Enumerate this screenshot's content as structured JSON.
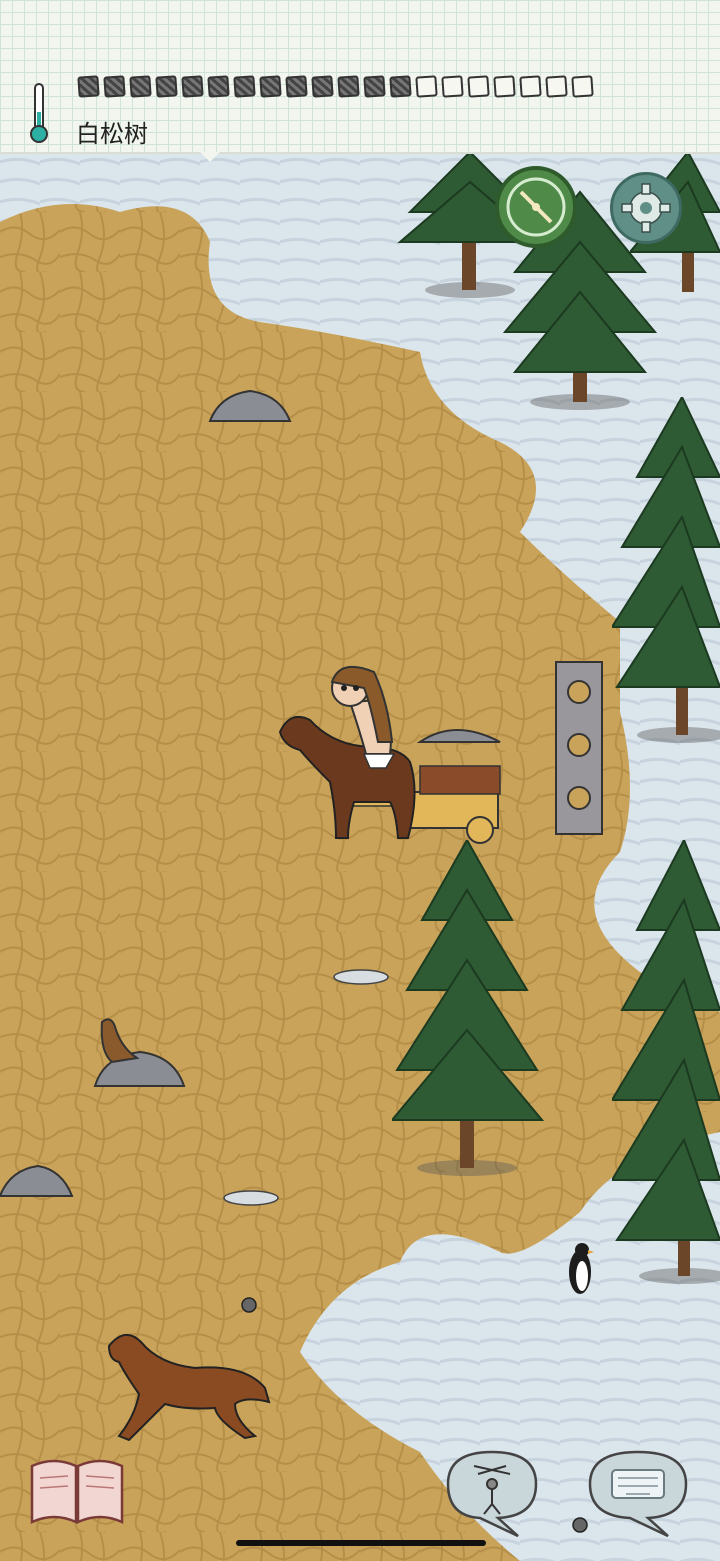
{
  "hud": {
    "object_label": "白松树",
    "food_pips_total": 20,
    "food_pips_filled": 13,
    "temperature_level": 0.35
  },
  "colors": {
    "snow": "#dfe8ee",
    "ground": "#c9a35a",
    "ground_dark": "#a9823c",
    "pine": "#2e5a34",
    "trunk": "#6b4628",
    "compass": "#4f8a48",
    "settings": "#5f8f86",
    "thermometer": "#2bb0a3"
  },
  "icons": {
    "thermometer": "thermometer-icon",
    "compass": "compass-icon",
    "settings": "gear-icon",
    "tech_tree": "book-icon",
    "emote": "puppet-icon",
    "keyboard": "keyboard-icon"
  }
}
